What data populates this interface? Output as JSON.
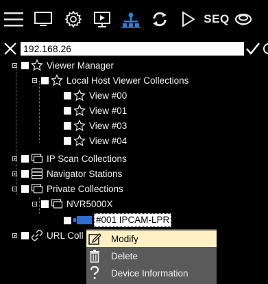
{
  "toolbar": {
    "items": [
      {
        "name": "menu"
      },
      {
        "name": "monitor"
      },
      {
        "name": "settings"
      },
      {
        "name": "presentation"
      },
      {
        "name": "network"
      },
      {
        "name": "refresh"
      },
      {
        "name": "play"
      },
      {
        "name": "sequence",
        "label": "SEQ"
      },
      {
        "name": "database"
      }
    ]
  },
  "filter": {
    "value": "192.168.26"
  },
  "tree": {
    "viewer_manager": "Viewer Manager",
    "local_host": "Local Host Viewer Collections",
    "views": [
      "View #00",
      "View #01",
      "View #03",
      "View #04"
    ],
    "ip_scan": "IP Scan Collections",
    "navigator": "Navigator Stations",
    "private": "Private Collections",
    "nvr": "NVR5000X",
    "camera": "#001 IPCAM-LPR",
    "url": "URL Coll"
  },
  "context_menu": {
    "items": [
      {
        "label": "Modify",
        "icon": "edit-icon",
        "highlighted": true
      },
      {
        "label": "Delete",
        "icon": "trash-icon",
        "highlighted": false
      },
      {
        "label": "Device Information",
        "icon": "question-icon",
        "highlighted": false
      }
    ]
  },
  "colors": {
    "background": "#000000",
    "menu_bg": "#5a5a5a",
    "menu_highlight": "#fff1c4",
    "network_icon_blue": "#2f7fd8",
    "camera_icon_blue": "#2f6fd0"
  }
}
